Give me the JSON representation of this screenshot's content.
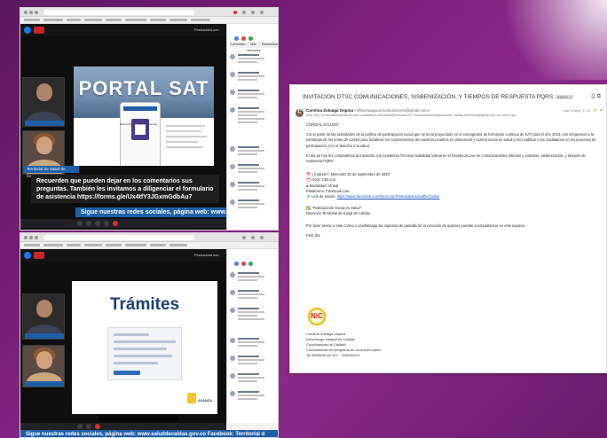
{
  "colors": {
    "background": "#7a1f7a",
    "accent_blue": "#1f5fa8",
    "live_red": "#c62828",
    "nic_red": "#d02a26",
    "nic_yellow": "#f2b705"
  },
  "top_shot": {
    "production_label": "Producción con",
    "portal_title": "PORTAL SAT",
    "nav_links": "Bienvenidos a nuestro principal",
    "speaker_label": "Territorial de Salud de Caldas",
    "caption": "Recuerden que pueden dejar en los comentarios sus preguntas. También les invitamos a diligenciar el formulario de asistencia https://forms.gle/Ux4tfY3JGxmGdbAu7",
    "banner": "Sigue nuestras redes sociales, página web: www.saludde",
    "chat_tabs": [
      "Comentarios",
      "Más relevantes",
      "Estadísticas"
    ]
  },
  "bottom_shot": {
    "production_label": "Producción con",
    "tramites_title": "Trámites",
    "banner": "Sigue nuestras redes sociales, página web: www.saluddecaldas.gov.co Facebook: Territorial d",
    "avanza_label": "AVANZA"
  },
  "email": {
    "subject": "INVITACION DTSC COMUNICACIONES, SISBENIZACIÓN, Y TIEMPOS DE RESPUESTA PQRS",
    "inbox_tag": "INBOX ×",
    "sender_name": "Carolina Zuluaga Ospina",
    "sender_addr": "<ofisuzluagacomunicaciones@gmail.com>",
    "to_line": "para: lucy_henaocaldas@hotmail.com, calidadleos.comcaldas@hotmail.com, mcardonasalud@gmail.com, caldas.asmesoria@gmail.com, nic.centro.ips...",
    "date": "mar, 19 sept, 17:12",
    "greeting": "CORDIAL SALUDO.",
    "paragraph1": "Como parte de las actividades de la política de participación social que se tiene proyectado en el cronograma de formación continua de SAT para el año 2023, nos integramos a la estrategia de los entes de control para fortalecer los conocimientos de nuestros usuarios en planeación y control social en salud y así cualificar a los ciudadanos en los procesos de participación y en el derecho a la salud.",
    "paragraph2": "El día de hoy les compartimos la invitación a la Asistencia Técnica modalidad Virtual en el Facebook Live en comunicaciones internas y externas, sisbenización, y tiempos de respuesta PQRS",
    "when": "📅 ¿Cuándo?: Miércoles 20 de septiembre de 2023",
    "hour": "⏰ Hora: 3:00 p.m.",
    "mode": "● Modalidad: Virtual",
    "platform": "Plataforma: Facebook Live",
    "session_prefix": "🔗 Link de sesión:",
    "session_link": "https://www.facebook.com/DireccionTerritorialdeSaludDeCaldas",
    "hashtag": "✅ \"Participación Social en Salud\"",
    "org": "Dirección Territorial de Salud de Caldas",
    "request": "Por favor enviar a este correo o al whatsapp las capturas de pantalla de la conexión de quienes puedan acompañarnos en este espacio.",
    "closing": "Feliz día",
    "logo_text": "NIC",
    "sig_name": "Carolina Zuluaga Ospina.",
    "sig_role1": "Hoomóloga Integral de Calidas",
    "sig_role2": "Coordinadora de Calidad.",
    "sig_role3": "Coordinadora del programa de clínica de sueño",
    "sig_phone": "Tel 8833838 cel 312 - 3292959/22"
  }
}
